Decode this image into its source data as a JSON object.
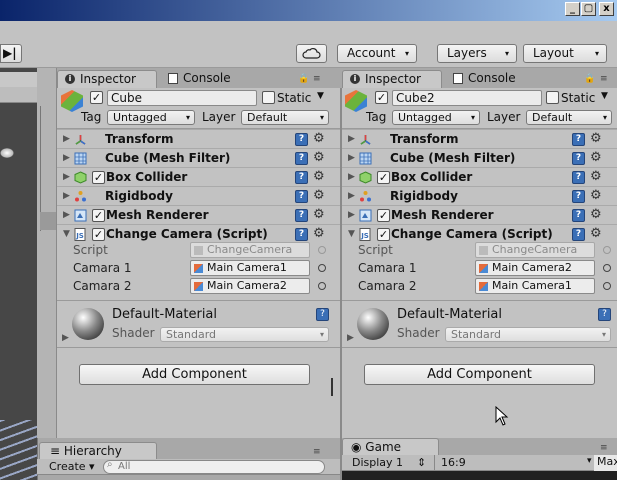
{
  "window": {
    "minimize": "_",
    "restore": "▢",
    "close": "x"
  },
  "toolbar": {
    "play_glyph": "▶|",
    "cloud_icon": "cloud-icon",
    "account": "Account",
    "layers": "Layers",
    "layout": "Layout",
    "dropdown_arrow": "▾"
  },
  "colors": {
    "panel": "#c2c2c2",
    "tabstrip": "#a8a8a8",
    "title_dark": "#0a246a",
    "help_blue": "#3b6fb6"
  },
  "inspector_left": {
    "tab_label": "Inspector",
    "tab_console": "Console",
    "object_name": "Cube",
    "active_checked": true,
    "static_label": "Static",
    "static_checked": false,
    "tag_label": "Tag",
    "tag_value": "Untagged",
    "layer_label": "Layer",
    "layer_value": "Default",
    "components": [
      {
        "name": "Transform",
        "icon": "transform-icon",
        "checkbox": false
      },
      {
        "name": "Cube (Mesh Filter)",
        "icon": "mesh-filter-icon",
        "checkbox": false
      },
      {
        "name": "Box Collider",
        "icon": "box-collider-icon",
        "checkbox": true
      },
      {
        "name": "Rigidbody",
        "icon": "rigidbody-icon",
        "checkbox": false
      },
      {
        "name": "Mesh Renderer",
        "icon": "mesh-renderer-icon",
        "checkbox": true
      },
      {
        "name": "Change Camera (Script)",
        "icon": "script-icon",
        "checkbox": true
      }
    ],
    "script_label": "Script",
    "script_value": "ChangeCamera",
    "camara1_label": "Camara 1",
    "camara1_value": "Main Camera1",
    "camara2_label": "Camara 2",
    "camara2_value": "Main Camera2",
    "material_name": "Default-Material",
    "shader_label": "Shader",
    "shader_value": "Standard",
    "add_component": "Add Component"
  },
  "inspector_right": {
    "tab_label": "Inspector",
    "tab_console": "Console",
    "object_name": "Cube2",
    "active_checked": true,
    "static_label": "Static",
    "static_checked": false,
    "tag_label": "Tag",
    "tag_value": "Untagged",
    "layer_label": "Layer",
    "layer_value": "Default",
    "components": [
      {
        "name": "Transform",
        "icon": "transform-icon",
        "checkbox": false
      },
      {
        "name": "Cube (Mesh Filter)",
        "icon": "mesh-filter-icon",
        "checkbox": false
      },
      {
        "name": "Box Collider",
        "icon": "box-collider-icon",
        "checkbox": true
      },
      {
        "name": "Rigidbody",
        "icon": "rigidbody-icon",
        "checkbox": false
      },
      {
        "name": "Mesh Renderer",
        "icon": "mesh-renderer-icon",
        "checkbox": true
      },
      {
        "name": "Change Camera (Script)",
        "icon": "script-icon",
        "checkbox": true
      }
    ],
    "script_label": "Script",
    "script_value": "ChangeCamera",
    "camara1_label": "Camara 1",
    "camara1_value": "Main Camera2",
    "camara2_label": "Camara 2",
    "camara2_value": "Main Camera1",
    "material_name": "Default-Material",
    "shader_label": "Shader",
    "shader_value": "Standard",
    "add_component": "Add Component"
  },
  "hierarchy": {
    "tab_label": "Hierarchy",
    "create_label": "Create",
    "search_placeholder": "All"
  },
  "game": {
    "tab_label": "Game",
    "display": "Display 1",
    "aspect": "16:9",
    "max_label": "Max"
  }
}
